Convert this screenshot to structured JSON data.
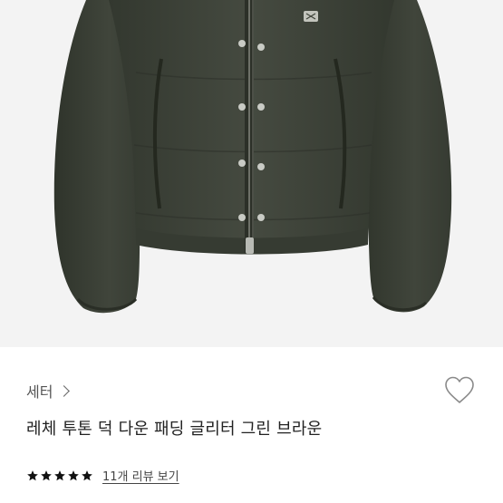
{
  "product": {
    "category_label": "세터",
    "title": "레체 투톤 덕 다운 패딩 글리터 그린 브라운",
    "review_link": "11개 리뷰 보기",
    "rating_stars": 5,
    "icons": {
      "breadcrumb": "chevron-right-icon",
      "wishlist": "heart-icon",
      "rating": "star-icon"
    },
    "colors": {
      "jacket": "#3d4238",
      "background": "#f3f3f3",
      "star": "#111111"
    }
  }
}
